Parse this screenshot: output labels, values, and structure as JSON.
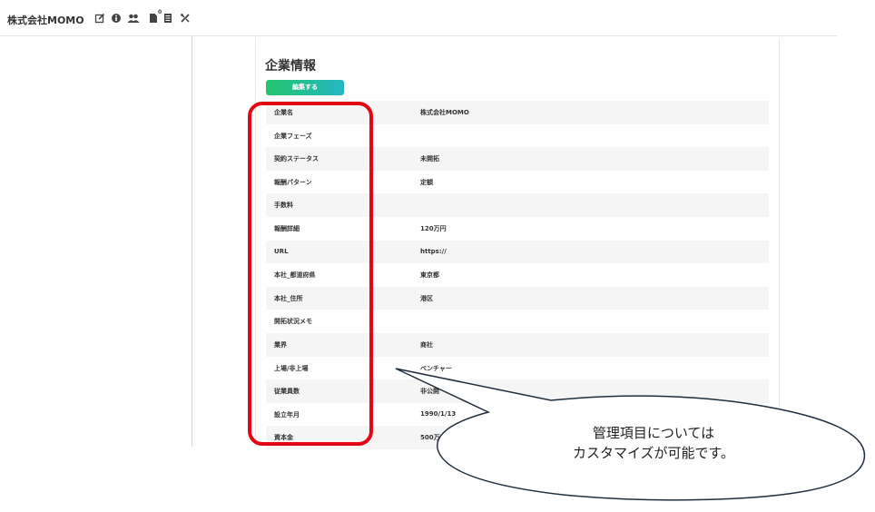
{
  "header": {
    "company_name": "株式会社MOMO",
    "icons": [
      "edit-icon",
      "info-icon",
      "users-icon",
      "document-icon",
      "list-icon",
      "tools-icon"
    ],
    "document_count": "0"
  },
  "section": {
    "title": "企業情報",
    "edit_label": "編集する"
  },
  "rows": [
    {
      "label": "企業名",
      "value": "株式会社MOMO"
    },
    {
      "label": "企業フェーズ",
      "value": ""
    },
    {
      "label": "契約ステータス",
      "value": "未開拓"
    },
    {
      "label": "報酬パターン",
      "value": "定額"
    },
    {
      "label": "手数料",
      "value": ""
    },
    {
      "label": "報酬詳細",
      "value": "120万円"
    },
    {
      "label": "URL",
      "value": "https://"
    },
    {
      "label": "本社_都道府県",
      "value": "東京都"
    },
    {
      "label": "本社_住所",
      "value": "港区"
    },
    {
      "label": "開拓状況メモ",
      "value": ""
    },
    {
      "label": "業界",
      "value": "商社"
    },
    {
      "label": "上場/非上場",
      "value": "ベンチャー"
    },
    {
      "label": "従業員数",
      "value": "非公開"
    },
    {
      "label": "設立年月",
      "value": "1990/1/13"
    },
    {
      "label": "資本金",
      "value": "500万"
    }
  ],
  "callout": {
    "line1": "管理項目については",
    "line2": "カスタマイズが可能です。"
  },
  "colors": {
    "highlight": "#e30613",
    "button_start": "#22c56a",
    "button_end": "#24b7c4",
    "row_stripe": "#f5f5f5"
  }
}
